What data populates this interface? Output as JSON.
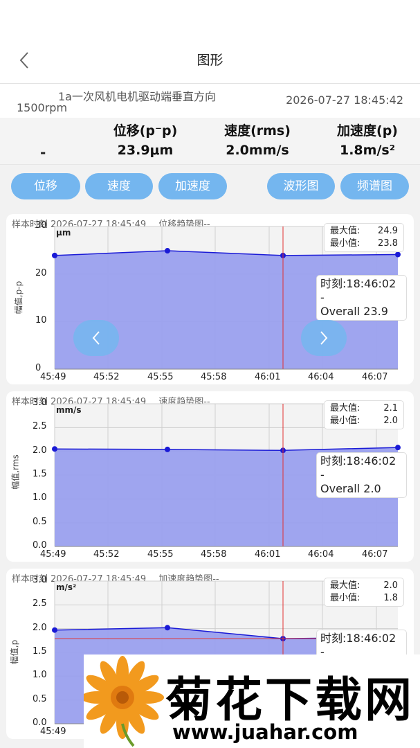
{
  "header": {
    "title": "图形",
    "back_icon": "chevron-left-icon"
  },
  "info": {
    "name_line1": "1a一次风机电机驱动端垂直方向",
    "name_line2": "1500rpm",
    "datetime": "2026-07-27 18:45:42"
  },
  "values": {
    "status": "-",
    "displacement_label": "位移(p⁻p)",
    "displacement_value": "23.9μm",
    "velocity_label": "速度(rms)",
    "velocity_value": "2.0mm/s",
    "acceleration_label": "加速度(p)",
    "acceleration_value": "1.8m/s²"
  },
  "buttons": {
    "displacement": "位移",
    "velocity": "速度",
    "acceleration": "加速度",
    "waveform": "波形图",
    "spectrum": "频谱图",
    "button_color": "#74b6ef"
  },
  "colors": {
    "fill": "#9aa0ee",
    "line": "#1a1ad6",
    "marker": "#e03030"
  },
  "chart_data": [
    {
      "type": "area",
      "header_sample": "样本时刻 2026-07-27 18:45:49",
      "header_title": "位移趋势图--",
      "ylabel": "幅值,p-p",
      "unit": "μm",
      "ylim": [
        0,
        30
      ],
      "yticks": [
        "0",
        "10",
        "20",
        "30"
      ],
      "x": [
        "45:49",
        "45:52",
        "45:55",
        "45:58",
        "46:01",
        "46:04",
        "46:07"
      ],
      "values": [
        23.9,
        24.9,
        23.9,
        24.1
      ],
      "max_label": "最大值:",
      "max_value": "24.9",
      "min_label": "最小值:",
      "min_value": "23.8",
      "tooltip_time": "时刻:18:46:02",
      "tooltip_dash": "-",
      "tooltip_value": "Overall 23.9",
      "grid": true
    },
    {
      "type": "area",
      "header_sample": "样本时刻 2026-07-27 18:45:49",
      "header_title": "速度趋势图--",
      "ylabel": "幅值,rms",
      "unit": "mm/s",
      "ylim": [
        0,
        3
      ],
      "yticks": [
        "0.0",
        "0.5",
        "1.0",
        "1.5",
        "2.0",
        "2.5",
        "3.0"
      ],
      "x": [
        "45:49",
        "45:52",
        "45:55",
        "45:58",
        "46:01",
        "46:04",
        "46:07"
      ],
      "values": [
        2.05,
        2.04,
        2.02,
        2.08
      ],
      "max_label": "最大值:",
      "max_value": "2.1",
      "min_label": "最小值:",
      "min_value": "2.0",
      "tooltip_time": "时刻:18:46:02",
      "tooltip_dash": "-",
      "tooltip_value": "Overall 2.0",
      "grid": true
    },
    {
      "type": "area",
      "header_sample": "样本时刻 2026-07-27 18:45:49",
      "header_title": "加速度趋势图--",
      "ylabel": "幅值,p",
      "unit": "m/s²",
      "ylim": [
        0,
        3
      ],
      "yticks": [
        "0.0",
        "0.5",
        "1.0",
        "1.5",
        "2.0",
        "2.5",
        "3.0"
      ],
      "x": [
        "45:49"
      ],
      "values": [
        1.97,
        2.02,
        1.79,
        1.82
      ],
      "max_label": "最大值:",
      "max_value": "2.0",
      "min_label": "最小值:",
      "min_value": "1.8",
      "tooltip_time": "时刻:18:46:02",
      "tooltip_dash": "-",
      "tooltip_value": "",
      "grid": true
    }
  ],
  "watermark": {
    "brand": "菊花下载网",
    "url": "www.juahar.com"
  }
}
